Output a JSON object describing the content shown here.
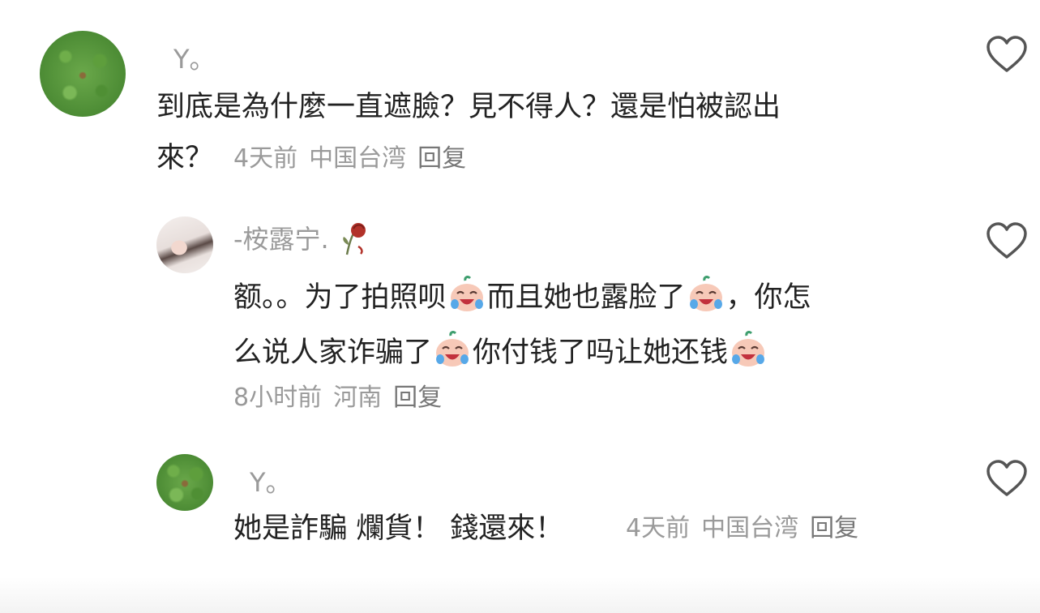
{
  "comments": [
    {
      "username": "Y。",
      "lines": [
        "到底是為什麼一直遮臉？見不得人？還是怕被認出",
        "來？"
      ],
      "time": "4天前",
      "location": "中国台湾",
      "reply": "回复",
      "avatar": "grass-photo",
      "icon": "heart-outline-icon"
    },
    {
      "username": "-桉露宁.",
      "user_icon": "wilted-rose-icon",
      "line1_parts": [
        "额。。为了拍照呗",
        "而且她也露脸了",
        "，你怎"
      ],
      "line2_parts": [
        "么说人家诈骗了",
        "你付钱了吗让她还钱",
        ""
      ],
      "emoji": "crying-laughing-face",
      "time": "8小时前",
      "location": "河南",
      "reply": "回复",
      "avatar": "person-photo",
      "icon": "heart-outline-icon"
    },
    {
      "username": "Y。",
      "text": "她是詐騙 爛貨！ 錢還來！",
      "time": "4天前",
      "location": "中国台湾",
      "reply": "回复",
      "avatar": "grass-photo",
      "icon": "heart-outline-icon"
    }
  ],
  "colors": {
    "text": "#222222",
    "muted": "#9a9a9a",
    "icon_stroke": "#555555"
  }
}
